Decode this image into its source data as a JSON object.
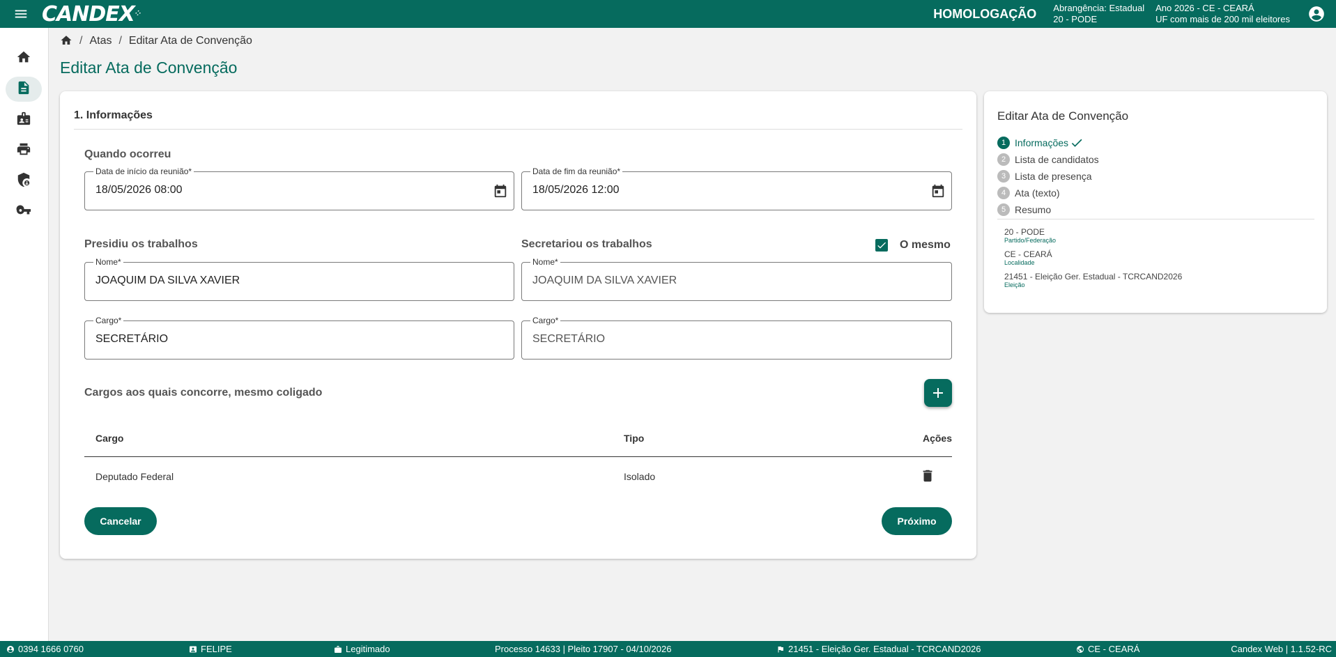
{
  "app": {
    "logo_text": "CANDEX",
    "environment": "HOMOLOGAÇÃO",
    "scope_line1": "Abrangência: Estadual",
    "scope_line2": "20 - PODE",
    "year_line1": "Ano 2026 - CE - CEARÁ",
    "year_line2": "UF com mais de 200 mil eleitores"
  },
  "sidenav": {
    "items": [
      {
        "name": "home-icon"
      },
      {
        "name": "document-icon"
      },
      {
        "name": "badge-icon"
      },
      {
        "name": "print-icon"
      },
      {
        "name": "shield-user-icon"
      },
      {
        "name": "key-icon"
      }
    ]
  },
  "breadcrumb": {
    "items": [
      "Atas",
      "Editar Ata de Convenção"
    ]
  },
  "page": {
    "title": "Editar Ata de Convenção"
  },
  "form": {
    "section_title": "1. Informações",
    "when_heading": "Quando ocorreu",
    "start_date": {
      "label": "Data de início da reunião*",
      "value": "18/05/2026 08:00"
    },
    "end_date": {
      "label": "Data de fim da reunião*",
      "value": "18/05/2026 12:00"
    },
    "presided_heading": "Presidiu os trabalhos",
    "secretary_heading": "Secretariou os trabalhos",
    "same_checkbox_label": "O mesmo",
    "same_checked": true,
    "presided_name": {
      "label": "Nome*",
      "value": "JOAQUIM DA SILVA XAVIER"
    },
    "secretary_name": {
      "label": "Nome*",
      "value": "JOAQUIM DA SILVA XAVIER"
    },
    "presided_role": {
      "label": "Cargo*",
      "value": "SECRETÁRIO"
    },
    "secretary_role": {
      "label": "Cargo*",
      "value": "SECRETÁRIO"
    },
    "positions_heading": "Cargos aos quais concorre, mesmo coligado",
    "table": {
      "headers": [
        "Cargo",
        "Tipo",
        "Ações"
      ],
      "rows": [
        {
          "cargo": "Deputado Federal",
          "tipo": "Isolado"
        }
      ]
    },
    "cancel_label": "Cancelar",
    "next_label": "Próximo"
  },
  "side_panel": {
    "title": "Editar Ata de Convenção",
    "steps": [
      {
        "num": "1",
        "label": "Informações",
        "active": true
      },
      {
        "num": "2",
        "label": "Lista de candidatos"
      },
      {
        "num": "3",
        "label": "Lista de presença"
      },
      {
        "num": "4",
        "label": "Ata (texto)"
      },
      {
        "num": "5",
        "label": "Resumo"
      }
    ],
    "summary": [
      {
        "value": "20 - PODE",
        "label": "Partido/Federação"
      },
      {
        "value": "CE - CEARÁ",
        "label": "Localidade"
      },
      {
        "value": "21451 - Eleição Ger. Estadual - TCRCAND2026",
        "label": "Eleição"
      }
    ]
  },
  "footer": {
    "user_id": "0394 1666 0760",
    "user_name": "FELIPE",
    "status": "Legitimado",
    "process": "Processo 14633 | Pleito 17907 - 04/10/2026",
    "election": "21451 - Eleição Ger. Estadual - TCRCAND2026",
    "location": "CE - CEARÁ",
    "version": "Candex Web | 1.1.52-RC"
  },
  "colors": {
    "primary": "#066b5e",
    "background": "#f2f2f2"
  }
}
